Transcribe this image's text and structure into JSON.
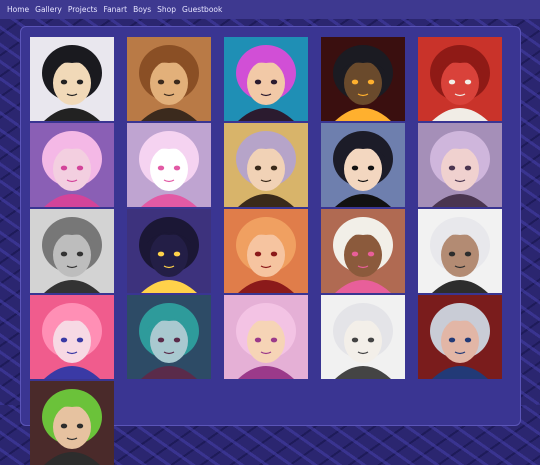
{
  "nav": {
    "items": [
      "Home",
      "Gallery",
      "Projects",
      "Fanart",
      "Boys",
      "Shop",
      "Guestbook"
    ]
  },
  "colors": {
    "nav_bar": "#3e3990",
    "page_bg": "#2b2670",
    "panel_bg": "#3a3592",
    "nav_text": "#e6e4ff"
  },
  "gallery": {
    "tiles": [
      {
        "name": "portrait-black-bob-hair",
        "bg": "#e9e7ee",
        "hair": "#1a1a1f",
        "skin": "#f1d9b8",
        "accent": "#222222"
      },
      {
        "name": "portrait-curly-auburn-hair",
        "bg": "#b97a46",
        "hair": "#8a4f25",
        "skin": "#e2b07a",
        "accent": "#3b2a1d"
      },
      {
        "name": "portrait-pink-hair-blue-bg",
        "bg": "#1f8fb5",
        "hair": "#d14fd6",
        "skin": "#f2c9a7",
        "accent": "#2b1b2f"
      },
      {
        "name": "portrait-horned-dark-fire",
        "bg": "#3a0f0f",
        "hair": "#1b1b22",
        "skin": "#6a4a2c",
        "accent": "#ffb02e"
      },
      {
        "name": "portrait-red-dragon",
        "bg": "#c9332a",
        "hair": "#8f1a16",
        "skin": "#d9423a",
        "accent": "#f1ede6"
      },
      {
        "name": "portrait-pink-curly-hair",
        "bg": "#8a5fb5",
        "hair": "#f4b8e6",
        "skin": "#f3cfe0",
        "accent": "#d3449a"
      },
      {
        "name": "portrait-pink-bunny-mask",
        "bg": "#bfa4d1",
        "hair": "#f5d3f1",
        "skin": "#ffffff",
        "accent": "#e25aa5"
      },
      {
        "name": "portrait-lilac-hair-gold",
        "bg": "#d8b46a",
        "hair": "#b6a4c9",
        "skin": "#f1d2b6",
        "accent": "#3a2a1a"
      },
      {
        "name": "portrait-beret-sunglasses",
        "bg": "#6e7fae",
        "hair": "#1c1c28",
        "skin": "#f3d7c0",
        "accent": "#111111"
      },
      {
        "name": "portrait-lavender-hair",
        "bg": "#a58fb8",
        "hair": "#cfb6dc",
        "skin": "#f0d1cf",
        "accent": "#4a3550"
      },
      {
        "name": "portrait-grayscale-sketch",
        "bg": "#d3d3d3",
        "hair": "#777777",
        "skin": "#bdbdbd",
        "accent": "#333333"
      },
      {
        "name": "portrait-black-cat-stars",
        "bg": "#3d327d",
        "hair": "#1b1735",
        "skin": "#231e46",
        "accent": "#ffd24a"
      },
      {
        "name": "portrait-ginger-red-eyes",
        "bg": "#e07d4a",
        "hair": "#f0a061",
        "skin": "#f6c4a0",
        "accent": "#8b1a1a"
      },
      {
        "name": "portrait-white-afro-glasses",
        "bg": "#b06a52",
        "hair": "#f2efe8",
        "skin": "#8b5a3c",
        "accent": "#e85f9a"
      },
      {
        "name": "portrait-white-hair-dark-skin",
        "bg": "#f2f2f2",
        "hair": "#e8e8ec",
        "skin": "#b38b73",
        "accent": "#2d2d2d"
      },
      {
        "name": "portrait-pink-jester",
        "bg": "#f05c8d",
        "hair": "#ff8fb5",
        "skin": "#f7d9e4",
        "accent": "#3a3aa5"
      },
      {
        "name": "portrait-teal-hair-butterflies",
        "bg": "#2d4b66",
        "hair": "#2e9b9b",
        "skin": "#a9c9d0",
        "accent": "#5a2b4a"
      },
      {
        "name": "portrait-pink-hood",
        "bg": "#e5b0d6",
        "hair": "#f3c3e4",
        "skin": "#f6d4b6",
        "accent": "#9b3a8a"
      },
      {
        "name": "portrait-white-long-hair",
        "bg": "#f1f1f1",
        "hair": "#e4e4e8",
        "skin": "#f3efe9",
        "accent": "#444444"
      },
      {
        "name": "portrait-masked-silver-hair",
        "bg": "#7a1c1c",
        "hair": "#c9ccd6",
        "skin": "#e2b6a6",
        "accent": "#223a77"
      },
      {
        "name": "portrait-green-hair-partial",
        "bg": "#4a2a2a",
        "hair": "#6bc23a",
        "skin": "#e6c2a0",
        "accent": "#2d2d2d"
      }
    ]
  }
}
